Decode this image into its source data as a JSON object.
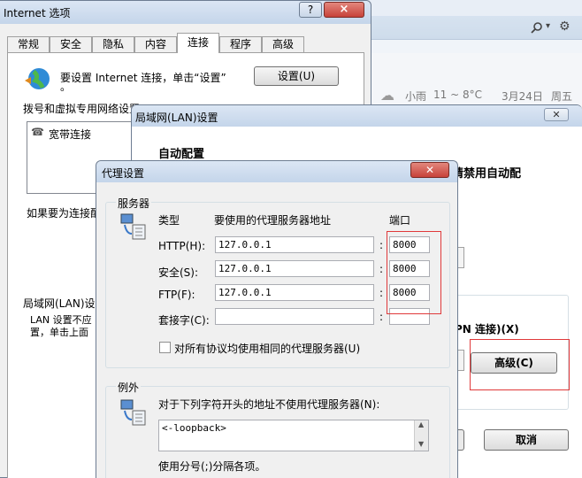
{
  "browser": {
    "weather_condition": "小雨",
    "temperature": "11 ~ 8°C",
    "date": "3月24日",
    "weekday": "周五"
  },
  "internet_options": {
    "title": "Internet 选项",
    "help_btn": "?",
    "close_btn": "×",
    "tabs": [
      "常规",
      "安全",
      "隐私",
      "内容",
      "连接",
      "程序",
      "高级"
    ],
    "setup_text": "要设置 Internet 连接，单击“设置”",
    "setup_text_cont": "。",
    "setup_btn": "设置(U)",
    "dialup_heading": "拨号和虚拟专用网络设置",
    "connection_item": "宽带连接",
    "proxy_hint": "如果要为连接配",
    "lan_heading": "局域网(LAN)设",
    "lan_desc_1": "LAN 设置不应",
    "lan_desc_2": "置，单击上面"
  },
  "lan_dialog": {
    "title": "局域网(LAN)设置",
    "close_btn": "✕",
    "auto_config": "自动配置",
    "auto_config_tail": "请禁用自动配",
    "vpn_text": "PN 连接)(X)",
    "advanced_btn": "高级(C)",
    "cancel_btn": "取消"
  },
  "proxy_dialog": {
    "title": "代理设置",
    "close_btn": "✕",
    "servers_group": "服务器",
    "col_type": "类型",
    "col_address": "要使用的代理服务器地址",
    "col_port": "端口",
    "rows": [
      {
        "label": "HTTP(H):",
        "address": "127.0.0.1",
        "port": "8000"
      },
      {
        "label": "安全(S):",
        "address": "127.0.0.1",
        "port": "8000"
      },
      {
        "label": "FTP(F):",
        "address": "127.0.0.1",
        "port": "8000"
      },
      {
        "label": "套接字(C):",
        "address": "",
        "port": ""
      }
    ],
    "colon": ":",
    "same_proxy": "对所有协议均使用相同的代理服务器(U)",
    "exceptions_group": "例外",
    "exceptions_desc": "对于下列字符开头的地址不使用代理服务器(N):",
    "exceptions_value": "<-loopback>",
    "separator_hint": "使用分号(;)分隔各项。"
  },
  "colors": {
    "highlight_red": "#e0393a",
    "title_bar": "#c4d5ea",
    "close_red": "#c7423a"
  }
}
